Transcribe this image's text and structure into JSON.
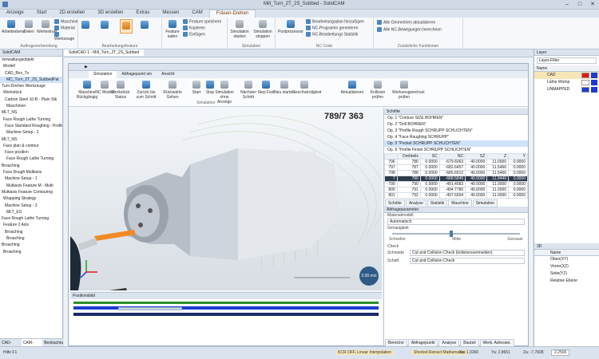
{
  "window": {
    "title": "Mill_Turn_2T_2S_Subbed - SolidCAM",
    "minimize": "–",
    "maximize": "□",
    "close": "✕"
  },
  "ribbon_tabs": [
    "Anzeige",
    "Start",
    "2D erstellen",
    "3D erstellen",
    "Extras",
    "Messen",
    "CAM",
    "Fräsen-Drehen"
  ],
  "contextual_tab_label": "Fräsen-Drehen",
  "ribbon": {
    "g1_btn1": "Arbeitsebene",
    "g1_btn2": "Zeilen",
    "g1_btn3": "Wertestrukt",
    "g1_btn4": "Maschine",
    "g1_btn5": "Material",
    "g1_btn6": "Werkzeuge",
    "g1_label": "Auftragsvorbereitung",
    "g2_label": "Bearbeitungsfeature",
    "g3_btn1": "Feature speichern",
    "g3_btn2": "Kopieren",
    "g3_btn3": "Einfügen",
    "g3_btn4": "Feature laden",
    "g4_btn1": "Simulation starten",
    "g4_btn2": "Simulation stoppen",
    "g4_label": "Simulation",
    "g5_btn1": "Postprozessor",
    "g5_btn2": "Bearbeitungsplan hinzufügen",
    "g5_btn3": "NC-Programm generieren",
    "g5_btn4": "NC-Bearbeitungs Statistik",
    "g5_label": "NC Code",
    "g6_btn1": "Alle Geometrien aktualisieren",
    "g6_btn2": "Alle NC-Bewegungen berechnen",
    "g6_label": "Zusätzliche Funktionen"
  },
  "left_panel": {
    "header": "SolidCAM",
    "items": [
      "Verwaltungsobjekt",
      "Modell",
      "CAD_Box_Tv",
      "MC_Turn_2T_2S_SubbedPat",
      "Turn-Drehen Werkzeuge",
      "Werkstück",
      "Carbon Steel 10-B - Plain Stk",
      "Maschinen",
      "MLT_NS",
      "Face Rough Lathe Turning",
      "Face Standard Roughing - Profile",
      "Machine Setup - 2",
      "MLT_NS",
      "Face plan & contour",
      "Face position",
      "Face Rough Lathe Turning",
      "Broaching",
      "Face Rough Multiaxis",
      "Machine Setup - 1",
      "Multiaxis Feature M - Multi",
      "Multiaxis Feature Contouring",
      "Wrapping Strategy",
      "Machine Setup - 3",
      "MLT_ES",
      "Face Rough Lathe Turning",
      "Feature 2 Axis",
      "Broaching",
      "Broaching",
      "Broaching",
      "Broaching"
    ],
    "bottom_tabs": [
      "CAD-Explorer",
      "CAM-Struktur",
      "Beobachtung"
    ]
  },
  "doc_tab": "SolidCAD 1 - Mill_Turn_2T_2S_Subbed",
  "sim": {
    "tabs": [
      "Simulation",
      "Abfragepunkt ein",
      "Ansicht"
    ],
    "btns": [
      "Maschine Rückgängig",
      "NC Modell",
      "Werkstück Status",
      "Zurück bis zum Schritt",
      "Rückwärts Gehen",
      "Start",
      "Stop",
      "Simulation ohne Anzeige",
      "Nächster Schritt",
      "Step Fwd",
      "Neu starten",
      "Geschwindigkeit",
      "Aktualisieren",
      "Kollision prüfen",
      "Werkzeugwechsel prüfen"
    ],
    "group_label": "Simulation",
    "coord": "789/7 363",
    "gauge": "2.00 m/s",
    "ops_header": "Schritte",
    "ops": [
      "Op. 1 \"Contour SIZE BOHREN\"",
      "Op. 2 \"Drill BOHREN\"",
      "Op. 3 \"Profile Rough SCHRUPP SCHLICHTEN\"",
      "Op. 4 \"Face Roughing SCHRUPP\"",
      "Op. 5 \"Pocket SCHRUPP SCHLICHTEN\"",
      "Op. 6 \"Profile Finish SCHRUPP SCHLICHTEN\""
    ],
    "table_header": [
      "",
      "Drehteils",
      "SC",
      "NC",
      "SZ",
      "Z",
      "Y"
    ],
    "table_rows": [
      [
        "796",
        "786",
        "0.0000",
        "-679.6063",
        "40.0000",
        "11.0000",
        "0.0000"
      ],
      [
        "797",
        "787",
        "0.0000",
        "-682.6457",
        "40.0000",
        "11.5466",
        "0.0000"
      ],
      [
        "798",
        "788",
        "0.0000",
        "-685.6912",
        "40.0000",
        "11.5466",
        "0.0000"
      ],
      [
        "7",
        "789",
        "0.0000",
        "-688.5849",
        "40.0000",
        "11.9449",
        "0.0000"
      ],
      [
        "799",
        "790",
        "0.0000",
        "-491.4583",
        "40.0000",
        "11.0000",
        "0.0000"
      ],
      [
        "800",
        "791",
        "0.0000",
        "-494.7780",
        "40.0000",
        "11.0000",
        "0.0000"
      ],
      [
        "801",
        "792",
        "0.0000",
        "-497.6004",
        "40.0000",
        "11.0000",
        "0.0000"
      ]
    ],
    "panel_tabs": [
      "Schritte",
      "Analyse",
      "Statistik",
      "Maschine",
      "Simulation"
    ],
    "options_header": "Abfrageparameter",
    "material_label": "Materialmodell",
    "material_value": "Automatisch",
    "speed_label": "Genauigkeit",
    "speed_marks": [
      "Schneller",
      "Mitte",
      "Genauer"
    ],
    "check_label": "Check",
    "cut_label": "Schneide",
    "cut_value": "Cut and Collision Check (kolisionsvermeiden)",
    "shaft_label": "Schaft",
    "shaft_value": "Cut and Collision Check",
    "bottom_tabs2": [
      "Bereiche",
      "Abfragepunkt",
      "Analyse",
      "Bauteil",
      "Werk. Adressei."
    ],
    "bottom_title": "Positionsbild",
    "status_mid1": "KCR OFF, Linear Interpolation",
    "status_mid2": "Shorted Retract Mathematics"
  },
  "layers": {
    "header": "Layer",
    "filter": "Layer-Filter",
    "col": "Name",
    "rows": [
      {
        "name": "CAD",
        "color": "#e01818"
      },
      {
        "name": "Lathe Workp",
        "color": "#ffffff"
      },
      {
        "name": "UNMAPPED",
        "color": "#1b3bd1"
      }
    ],
    "section2": "3D",
    "col2": "Name",
    "rows2": [
      "Oben(XY)",
      "Vorne(XZ)",
      "Seite(YZ)",
      "Relative Ebene"
    ]
  },
  "status": {
    "left": "Hilfe F1",
    "x": "Xa: 1.0260",
    "y": "Ya: 2.8651",
    "z": "Za: -7.7828",
    "zoom": "2.2500"
  }
}
